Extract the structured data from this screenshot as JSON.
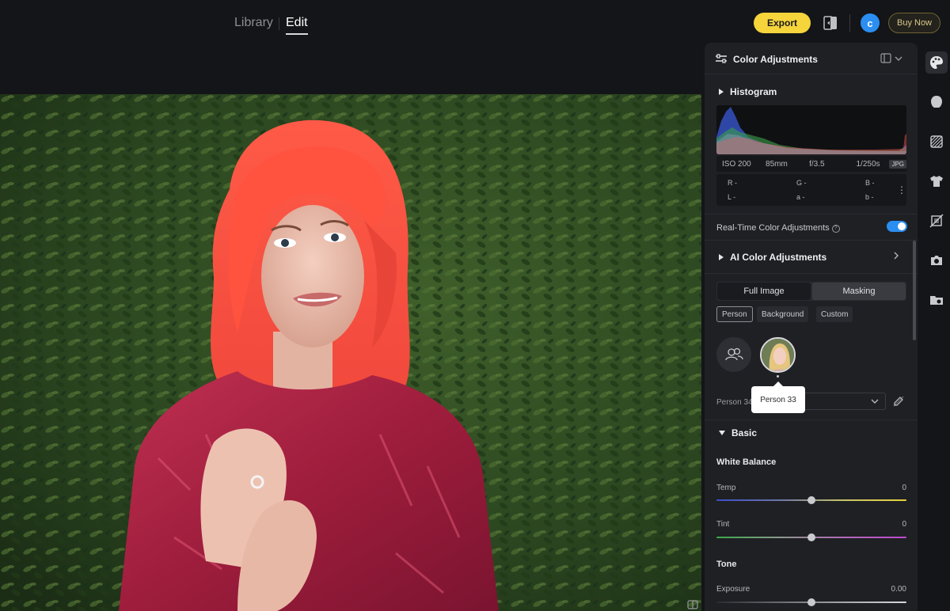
{
  "topbar": {
    "tabs": [
      "Library",
      "Edit"
    ],
    "active_tab": "Edit",
    "export_label": "Export",
    "avatar_letter": "c",
    "buy_label": "Buy Now"
  },
  "panel": {
    "title": "Color Adjustments",
    "histogram": {
      "title": "Histogram",
      "exif": {
        "iso": "ISO 200",
        "focal": "85mm",
        "aperture": "f/3.5",
        "shutter": "1/250s",
        "format": "JPG"
      },
      "readout": {
        "r": "R -",
        "g": "G -",
        "b": "B -",
        "l": "L -",
        "a": "a -",
        "b2": "b -"
      }
    },
    "realtime_label": "Real-Time Color Adjustments",
    "realtime_on": true,
    "ai_title": "AI Color Adjustments",
    "segments": [
      "Full Image",
      "Masking"
    ],
    "active_segment": "Masking",
    "mask_chips": [
      "Person",
      "Background",
      "Custom"
    ],
    "active_chip": "Person",
    "person_label": "Person 34",
    "tooltip": "Person 33",
    "basic": {
      "title": "Basic",
      "white_balance": "White Balance",
      "temp": {
        "label": "Temp",
        "value": "0",
        "level": 0.5
      },
      "tint": {
        "label": "Tint",
        "value": "0",
        "level": 0.5
      },
      "tone": "Tone",
      "exposure": {
        "label": "Exposure",
        "value": "0.00",
        "level": 0.5
      }
    }
  },
  "rail": [
    "palette-icon",
    "face-icon",
    "texture-icon",
    "clothing-icon",
    "crop-icon",
    "camera-icon",
    "folder-icon"
  ],
  "colors": {
    "accent": "#2b8ef0",
    "export": "#f5d43c",
    "panel": "#1f2024",
    "background": "#141518"
  }
}
